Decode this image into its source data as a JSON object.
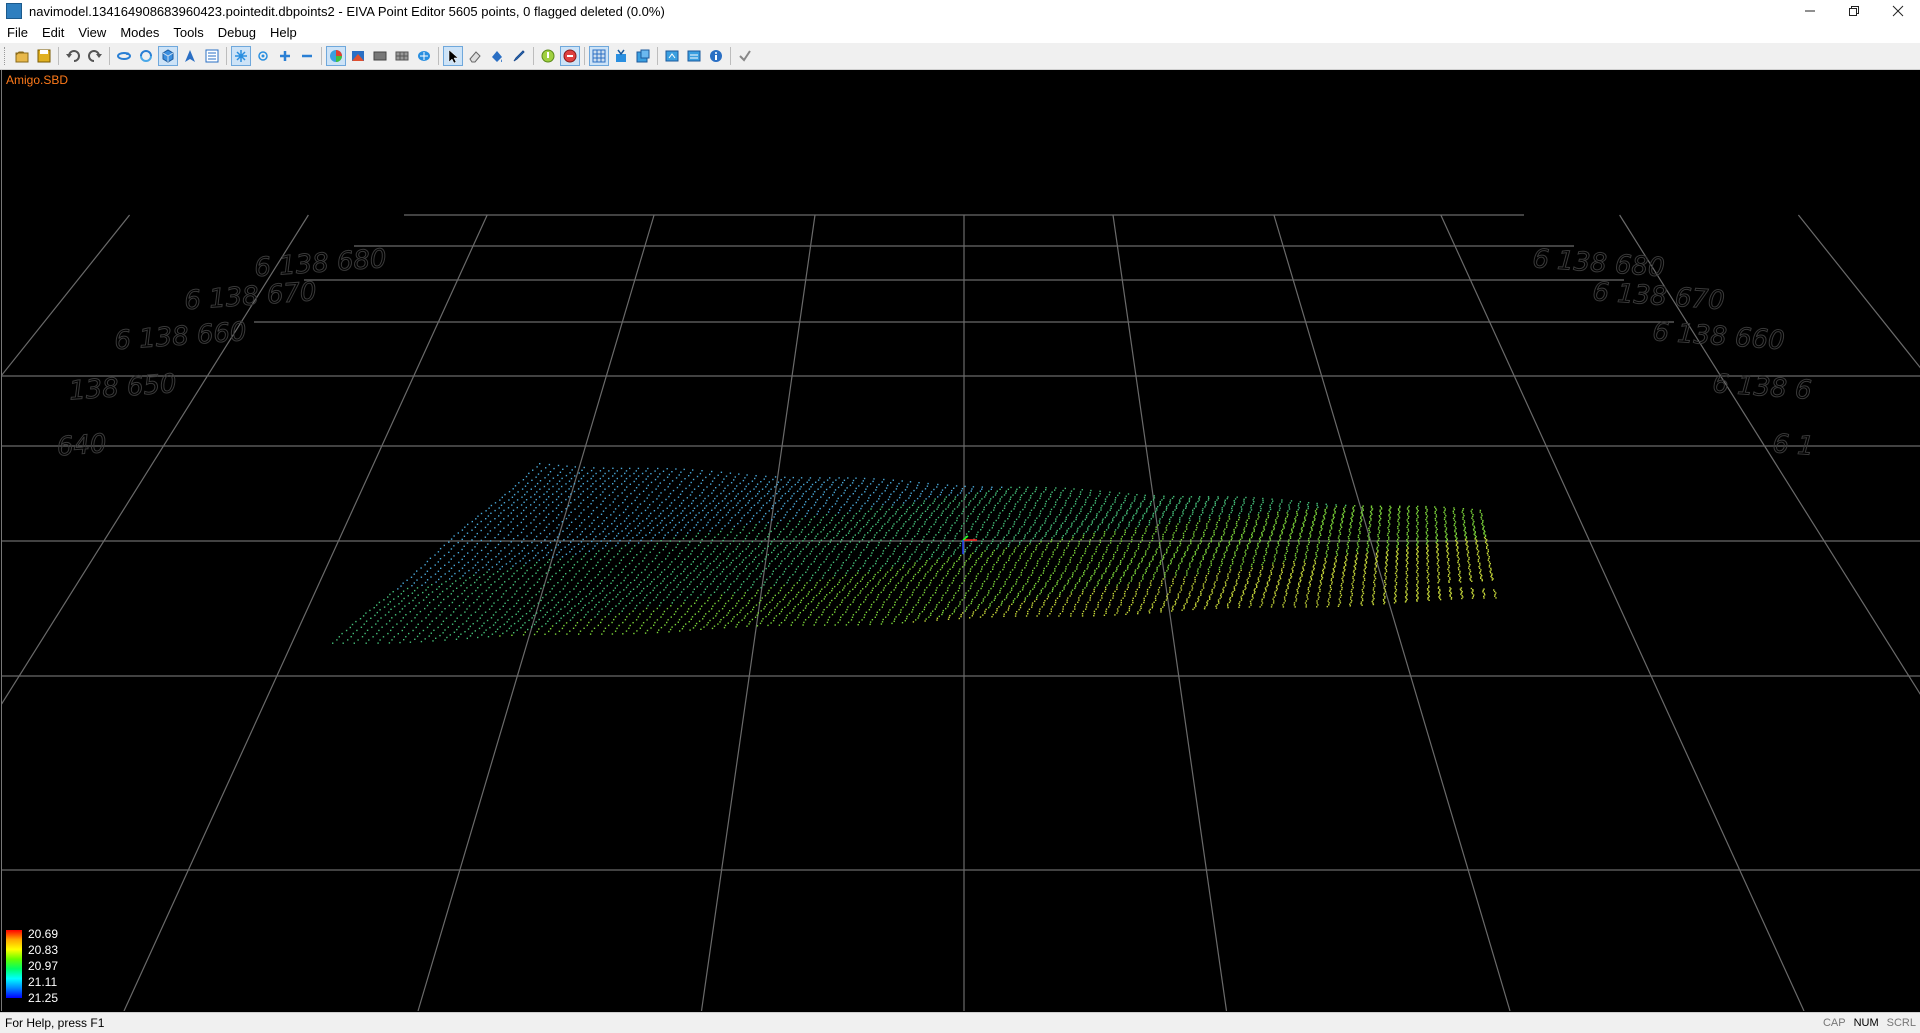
{
  "window": {
    "title": "navimodel.134164908683960423.pointedit.dbpoints2 - EIVA Point Editor 5605 points, 0 flagged deleted (0.0%)",
    "controls": [
      "minimize",
      "restore",
      "close"
    ]
  },
  "menu": [
    "File",
    "Edit",
    "View",
    "Modes",
    "Tools",
    "Debug",
    "Help"
  ],
  "toolbar": {
    "groups": [
      [
        "open-icon",
        "save-icon"
      ],
      [
        "undo-icon",
        "redo-icon"
      ],
      [
        "rotate-view-icon",
        "refresh-icon",
        "cube-view-icon",
        "north-arrow-icon",
        "list-icon"
      ],
      [
        "snowflake-icon",
        "point-icon",
        "plus-icon",
        "minus-icon"
      ],
      [
        "color-by-depth-icon",
        "shade-icon",
        "surface-icon",
        "mesh-icon",
        "layers-icon"
      ],
      [
        "select-arrow-icon",
        "eraser-icon",
        "fill-icon",
        "pen-icon"
      ],
      [
        "accept-circle-icon",
        "reject-circle-icon"
      ],
      [
        "grid-icon",
        "import-icon",
        "export-icon"
      ],
      [
        "export-data-icon",
        "compare-icon",
        "info-icon"
      ],
      [
        "checkmark-icon"
      ]
    ],
    "active": [
      "cube-view-icon",
      "snowflake-icon",
      "color-by-depth-icon",
      "select-arrow-icon",
      "reject-circle-icon",
      "grid-icon"
    ]
  },
  "viewport": {
    "layer_name": "Amigo.SBD",
    "grid_labels_left": [
      "6 138 680",
      "6 138 670",
      "6 138 660",
      "138 650",
      "640"
    ],
    "grid_labels_right": [
      "6 138 680",
      "6 138 670",
      "6 138 660",
      "6 138 6",
      "6 1"
    ],
    "point_colors": [
      "#4aa8d8",
      "#45c07a",
      "#7cd63a",
      "#c8d93a"
    ]
  },
  "legend": {
    "values": [
      "20.69",
      "20.83",
      "20.97",
      "21.11",
      "21.25"
    ],
    "colors": [
      "#ff0000",
      "#ffff00",
      "#00ff66",
      "#00ffff",
      "#0000ff"
    ]
  },
  "status": {
    "help_text": "For Help, press F1",
    "indicators": [
      {
        "label": "CAP",
        "on": false
      },
      {
        "label": "NUM",
        "on": true
      },
      {
        "label": "SCRL",
        "on": false
      }
    ]
  }
}
